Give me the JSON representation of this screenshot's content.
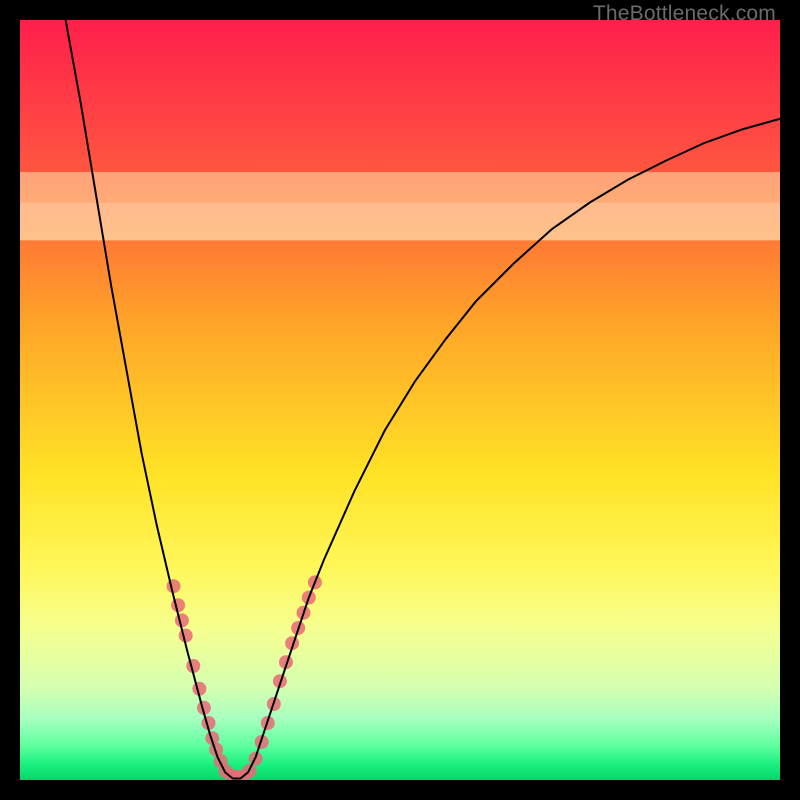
{
  "watermark": "TheBottleneck.com",
  "chart_data": {
    "type": "line",
    "title": "",
    "xlabel": "",
    "ylabel": "",
    "xlim": [
      0,
      100
    ],
    "ylim": [
      0,
      100
    ],
    "grid": false,
    "legend": false,
    "background_gradient": {
      "stops": [
        {
          "offset": 0.0,
          "color": "#ff1f4b"
        },
        {
          "offset": 0.2,
          "color": "#ff5640"
        },
        {
          "offset": 0.4,
          "color": "#ffa528"
        },
        {
          "offset": 0.6,
          "color": "#ffe326"
        },
        {
          "offset": 0.72,
          "color": "#fff75a"
        },
        {
          "offset": 0.8,
          "color": "#f6ff8f"
        },
        {
          "offset": 0.88,
          "color": "#d4ffb1"
        },
        {
          "offset": 0.92,
          "color": "#a6ffc0"
        },
        {
          "offset": 0.955,
          "color": "#5eff9e"
        },
        {
          "offset": 0.98,
          "color": "#19f07e"
        },
        {
          "offset": 1.0,
          "color": "#06d66a"
        }
      ]
    },
    "band_overlays": [
      {
        "y0": 71,
        "y1": 76,
        "color": "rgba(255,255,210,0.55)"
      },
      {
        "y0": 76,
        "y1": 80,
        "color": "rgba(255,255,190,0.45)"
      }
    ],
    "series": [
      {
        "name": "curve",
        "color": "#000000",
        "width": 2,
        "points": [
          {
            "x": 6.0,
            "y": 100.0
          },
          {
            "x": 8.0,
            "y": 89.0
          },
          {
            "x": 10.0,
            "y": 77.0
          },
          {
            "x": 12.0,
            "y": 65.0
          },
          {
            "x": 14.0,
            "y": 54.0
          },
          {
            "x": 16.0,
            "y": 43.0
          },
          {
            "x": 18.0,
            "y": 33.5
          },
          {
            "x": 20.0,
            "y": 25.0
          },
          {
            "x": 22.0,
            "y": 17.0
          },
          {
            "x": 24.0,
            "y": 9.5
          },
          {
            "x": 25.0,
            "y": 6.0
          },
          {
            "x": 26.0,
            "y": 3.0
          },
          {
            "x": 27.0,
            "y": 1.0
          },
          {
            "x": 28.0,
            "y": 0.2
          },
          {
            "x": 29.0,
            "y": 0.2
          },
          {
            "x": 30.0,
            "y": 1.0
          },
          {
            "x": 31.0,
            "y": 3.0
          },
          {
            "x": 32.0,
            "y": 6.0
          },
          {
            "x": 34.0,
            "y": 12.0
          },
          {
            "x": 36.0,
            "y": 18.0
          },
          {
            "x": 38.0,
            "y": 24.0
          },
          {
            "x": 40.0,
            "y": 29.0
          },
          {
            "x": 44.0,
            "y": 38.0
          },
          {
            "x": 48.0,
            "y": 46.0
          },
          {
            "x": 52.0,
            "y": 52.5
          },
          {
            "x": 56.0,
            "y": 58.0
          },
          {
            "x": 60.0,
            "y": 63.0
          },
          {
            "x": 65.0,
            "y": 68.0
          },
          {
            "x": 70.0,
            "y": 72.5
          },
          {
            "x": 75.0,
            "y": 76.0
          },
          {
            "x": 80.0,
            "y": 79.0
          },
          {
            "x": 85.0,
            "y": 81.5
          },
          {
            "x": 90.0,
            "y": 83.8
          },
          {
            "x": 95.0,
            "y": 85.6
          },
          {
            "x": 100.0,
            "y": 87.0
          }
        ]
      }
    ],
    "scatter": [
      {
        "name": "points-left",
        "color": "#e76a76",
        "radius": 7,
        "points": [
          {
            "x": 20.2,
            "y": 25.5
          },
          {
            "x": 20.8,
            "y": 23.0
          },
          {
            "x": 21.3,
            "y": 21.0
          },
          {
            "x": 21.8,
            "y": 19.0
          },
          {
            "x": 22.8,
            "y": 15.0
          },
          {
            "x": 23.6,
            "y": 12.0
          },
          {
            "x": 24.2,
            "y": 9.5
          },
          {
            "x": 24.8,
            "y": 7.5
          },
          {
            "x": 25.3,
            "y": 5.5
          },
          {
            "x": 25.8,
            "y": 4.0
          },
          {
            "x": 26.4,
            "y": 2.5
          },
          {
            "x": 27.0,
            "y": 1.2
          },
          {
            "x": 27.8,
            "y": 0.6
          },
          {
            "x": 28.6,
            "y": 0.4
          }
        ]
      },
      {
        "name": "points-right",
        "color": "#e76a76",
        "radius": 7,
        "points": [
          {
            "x": 29.4,
            "y": 0.5
          },
          {
            "x": 30.2,
            "y": 1.2
          },
          {
            "x": 31.0,
            "y": 2.8
          },
          {
            "x": 31.8,
            "y": 5.0
          },
          {
            "x": 32.6,
            "y": 7.5
          },
          {
            "x": 33.4,
            "y": 10.0
          },
          {
            "x": 34.2,
            "y": 13.0
          },
          {
            "x": 35.0,
            "y": 15.5
          },
          {
            "x": 35.8,
            "y": 18.0
          },
          {
            "x": 36.6,
            "y": 20.0
          },
          {
            "x": 37.3,
            "y": 22.0
          },
          {
            "x": 38.0,
            "y": 24.0
          },
          {
            "x": 38.8,
            "y": 26.0
          }
        ]
      }
    ]
  }
}
